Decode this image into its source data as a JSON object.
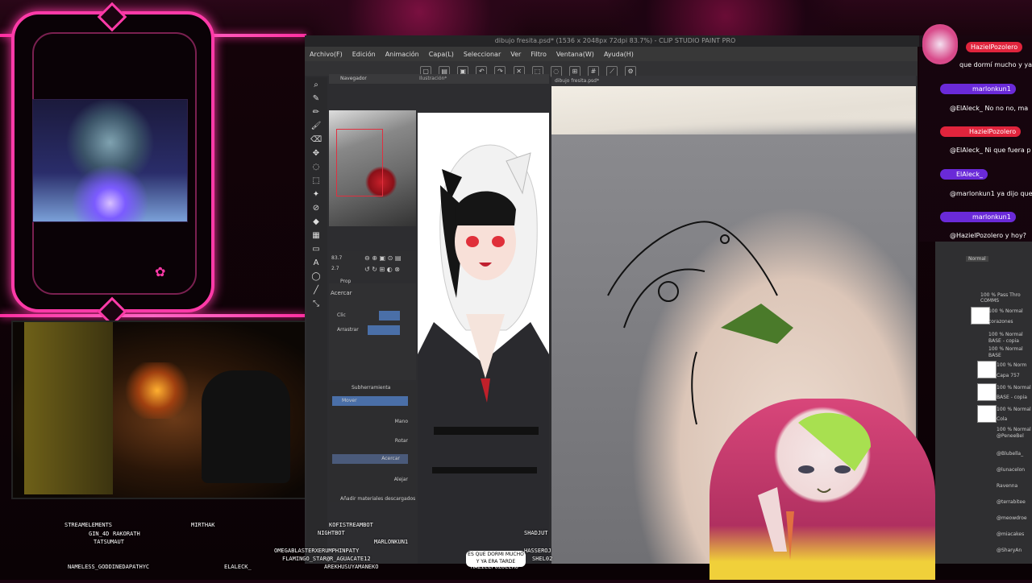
{
  "app": {
    "window_title": "dibujo fresita.psd* (1536 x 2048px 72dpi 83.7%) - CLIP STUDIO PAINT PRO",
    "menu": [
      "Archivo(F)",
      "Edición",
      "Animación",
      "Capa(L)",
      "Seleccionar",
      "Ver",
      "Filtro",
      "Ventana(W)",
      "Ayuda(H)"
    ],
    "panels": {
      "navigator": "Navegador",
      "illustration_tab": "Ilustración*",
      "canvas_tab": "dibujo fresita.psd*",
      "zoom": "83.7",
      "angle": "2.7",
      "prop_header": "Prop",
      "tool_title": "Acercar",
      "click_label": "Clic",
      "drag_label": "Arrastrar",
      "subtool_header": "Subherramienta",
      "subtools": [
        "Mover",
        "Mano",
        "Rotar",
        "Acercar",
        "Alejar"
      ],
      "add_materials": "Añadir materiales descargados"
    },
    "layers": {
      "blend": "Normal",
      "rows": [
        "100 % Pass Thro",
        "COMMS",
        "100 % Normal",
        "corazones",
        "100 % Normal",
        "BASE - copia",
        "100 % Normal",
        "BASE",
        "100 % Norm",
        "Capa 757",
        "100 % Normal",
        "BASE - copia",
        "100 % Normal",
        "Cola",
        "100 % Normal",
        "@PeneeBel",
        "@Blubella_",
        "@lunacelon",
        "Ravenna",
        "@terrabitee",
        "@meowdroe",
        "@miacakes",
        "@SharyAn"
      ]
    }
  },
  "chat": [
    {
      "name": "HazielPozolero",
      "message": "que dormí mucho y ya",
      "name_color": "#e0243c"
    },
    {
      "name": "marlonkun1",
      "message": "@ElAleck_ No no no, ma",
      "name_color": "#6a2ad8"
    },
    {
      "name": "HazielPozolero",
      "message": "@ElAleck_ Ni que fuera p",
      "name_color": "#e0243c"
    },
    {
      "name": "ElAleck_",
      "message": "@marlonkun1 ya dijo que",
      "name_color": "#6a2ad8"
    },
    {
      "name": "marlonkun1",
      "message": "@HazielPozolero y hoy?",
      "name_color": "#6a2ad8"
    }
  ],
  "viewers": [
    "STREAMELEMENTS",
    "GIN_4D",
    "RAKORATH",
    "MIRTHAK",
    "TATSUMAUT",
    "KOFISTREAMBOT",
    "NIGHTBOT",
    "MARLONKUN1",
    "SHADJUT",
    "OMEGABLASTERXERUMPHINPATY",
    "FLAMINGO_STAR@R_AGUACATE12",
    "HASSEROJ",
    "SHEL02",
    "ELALECK_",
    "AREKHUSUYAMANEKO",
    "HAZIELPOZOLERO",
    "NAMELESS_GODDINEDAPATHYC"
  ],
  "caption_bubble": "ES QUE DORMI MUCHO Y YA ERA TARDE",
  "colors": {
    "accent": "#ff3aa8",
    "frame": "#1a0410"
  }
}
